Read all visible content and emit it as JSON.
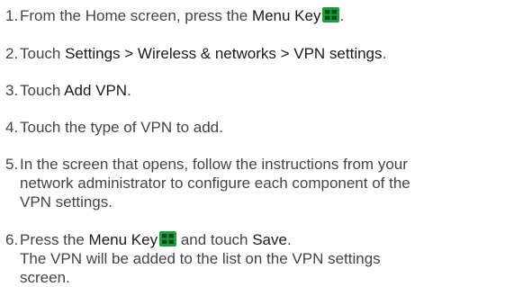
{
  "steps": [
    {
      "num": "1.",
      "t1": "From the Home screen, press the ",
      "kw1": "Menu Key",
      "t2": "."
    },
    {
      "num": "2.",
      "t1": "Touch ",
      "kw1": "Settings > Wireless & networks > VPN settings",
      "t2": "."
    },
    {
      "num": "3.",
      "t1": "Touch ",
      "kw1": "Add VPN",
      "t2": "."
    },
    {
      "num": "4.",
      "t1": "Touch the type of VPN to add."
    },
    {
      "num": "5.",
      "line1": "In the screen that opens, follow the instructions from your",
      "line2": "network administrator to configure each component of the",
      "line3": "VPN settings."
    },
    {
      "num": "6.",
      "t1": "Press the ",
      "kw1": "Menu Key",
      "t2": " and touch ",
      "kw2": "Save",
      "t3": ".",
      "line2": "The VPN will be added to the list on the VPN settings",
      "line3": "screen."
    }
  ],
  "icons": {
    "menu_key": "menu-key-icon",
    "menu_key_color": "#1f9d3a"
  }
}
